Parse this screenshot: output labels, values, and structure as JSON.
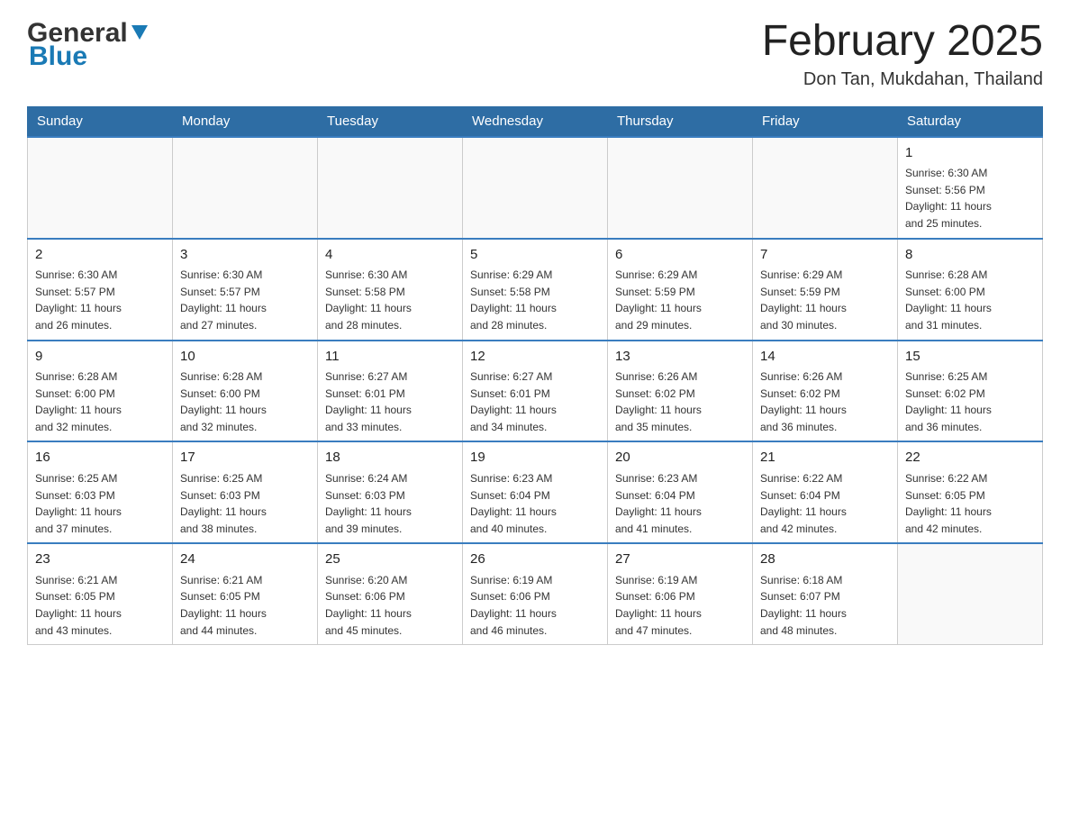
{
  "header": {
    "logo_general": "General",
    "logo_blue": "Blue",
    "month_title": "February 2025",
    "location": "Don Tan, Mukdahan, Thailand"
  },
  "days_of_week": [
    "Sunday",
    "Monday",
    "Tuesday",
    "Wednesday",
    "Thursday",
    "Friday",
    "Saturday"
  ],
  "weeks": [
    [
      {
        "day": "",
        "info": ""
      },
      {
        "day": "",
        "info": ""
      },
      {
        "day": "",
        "info": ""
      },
      {
        "day": "",
        "info": ""
      },
      {
        "day": "",
        "info": ""
      },
      {
        "day": "",
        "info": ""
      },
      {
        "day": "1",
        "info": "Sunrise: 6:30 AM\nSunset: 5:56 PM\nDaylight: 11 hours\nand 25 minutes."
      }
    ],
    [
      {
        "day": "2",
        "info": "Sunrise: 6:30 AM\nSunset: 5:57 PM\nDaylight: 11 hours\nand 26 minutes."
      },
      {
        "day": "3",
        "info": "Sunrise: 6:30 AM\nSunset: 5:57 PM\nDaylight: 11 hours\nand 27 minutes."
      },
      {
        "day": "4",
        "info": "Sunrise: 6:30 AM\nSunset: 5:58 PM\nDaylight: 11 hours\nand 28 minutes."
      },
      {
        "day": "5",
        "info": "Sunrise: 6:29 AM\nSunset: 5:58 PM\nDaylight: 11 hours\nand 28 minutes."
      },
      {
        "day": "6",
        "info": "Sunrise: 6:29 AM\nSunset: 5:59 PM\nDaylight: 11 hours\nand 29 minutes."
      },
      {
        "day": "7",
        "info": "Sunrise: 6:29 AM\nSunset: 5:59 PM\nDaylight: 11 hours\nand 30 minutes."
      },
      {
        "day": "8",
        "info": "Sunrise: 6:28 AM\nSunset: 6:00 PM\nDaylight: 11 hours\nand 31 minutes."
      }
    ],
    [
      {
        "day": "9",
        "info": "Sunrise: 6:28 AM\nSunset: 6:00 PM\nDaylight: 11 hours\nand 32 minutes."
      },
      {
        "day": "10",
        "info": "Sunrise: 6:28 AM\nSunset: 6:00 PM\nDaylight: 11 hours\nand 32 minutes."
      },
      {
        "day": "11",
        "info": "Sunrise: 6:27 AM\nSunset: 6:01 PM\nDaylight: 11 hours\nand 33 minutes."
      },
      {
        "day": "12",
        "info": "Sunrise: 6:27 AM\nSunset: 6:01 PM\nDaylight: 11 hours\nand 34 minutes."
      },
      {
        "day": "13",
        "info": "Sunrise: 6:26 AM\nSunset: 6:02 PM\nDaylight: 11 hours\nand 35 minutes."
      },
      {
        "day": "14",
        "info": "Sunrise: 6:26 AM\nSunset: 6:02 PM\nDaylight: 11 hours\nand 36 minutes."
      },
      {
        "day": "15",
        "info": "Sunrise: 6:25 AM\nSunset: 6:02 PM\nDaylight: 11 hours\nand 36 minutes."
      }
    ],
    [
      {
        "day": "16",
        "info": "Sunrise: 6:25 AM\nSunset: 6:03 PM\nDaylight: 11 hours\nand 37 minutes."
      },
      {
        "day": "17",
        "info": "Sunrise: 6:25 AM\nSunset: 6:03 PM\nDaylight: 11 hours\nand 38 minutes."
      },
      {
        "day": "18",
        "info": "Sunrise: 6:24 AM\nSunset: 6:03 PM\nDaylight: 11 hours\nand 39 minutes."
      },
      {
        "day": "19",
        "info": "Sunrise: 6:23 AM\nSunset: 6:04 PM\nDaylight: 11 hours\nand 40 minutes."
      },
      {
        "day": "20",
        "info": "Sunrise: 6:23 AM\nSunset: 6:04 PM\nDaylight: 11 hours\nand 41 minutes."
      },
      {
        "day": "21",
        "info": "Sunrise: 6:22 AM\nSunset: 6:04 PM\nDaylight: 11 hours\nand 42 minutes."
      },
      {
        "day": "22",
        "info": "Sunrise: 6:22 AM\nSunset: 6:05 PM\nDaylight: 11 hours\nand 42 minutes."
      }
    ],
    [
      {
        "day": "23",
        "info": "Sunrise: 6:21 AM\nSunset: 6:05 PM\nDaylight: 11 hours\nand 43 minutes."
      },
      {
        "day": "24",
        "info": "Sunrise: 6:21 AM\nSunset: 6:05 PM\nDaylight: 11 hours\nand 44 minutes."
      },
      {
        "day": "25",
        "info": "Sunrise: 6:20 AM\nSunset: 6:06 PM\nDaylight: 11 hours\nand 45 minutes."
      },
      {
        "day": "26",
        "info": "Sunrise: 6:19 AM\nSunset: 6:06 PM\nDaylight: 11 hours\nand 46 minutes."
      },
      {
        "day": "27",
        "info": "Sunrise: 6:19 AM\nSunset: 6:06 PM\nDaylight: 11 hours\nand 47 minutes."
      },
      {
        "day": "28",
        "info": "Sunrise: 6:18 AM\nSunset: 6:07 PM\nDaylight: 11 hours\nand 48 minutes."
      },
      {
        "day": "",
        "info": ""
      }
    ]
  ]
}
